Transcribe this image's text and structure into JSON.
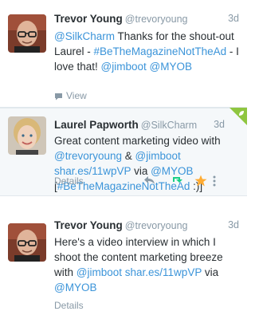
{
  "tweets": [
    {
      "fullname": "Trevor Young",
      "screenname": "@trevoryoung",
      "time": "3d",
      "avatar_icon": "bald-man-with-glasses-avatar",
      "text": [
        {
          "t": "@SilkCharm",
          "link": true
        },
        {
          "t": " Thanks for the shout-out Laurel - ",
          "link": false
        },
        {
          "t": "#BeTheMagazineNotTheAd",
          "link": true
        },
        {
          "t": " - I love that! ",
          "link": false
        },
        {
          "t": "@jimboot",
          "link": true
        },
        {
          "t": " ",
          "link": false
        },
        {
          "t": "@MYOB",
          "link": true
        }
      ],
      "footer_label": "View"
    },
    {
      "fullname": "Laurel Papworth",
      "screenname": "@SilkCharm",
      "time": "3d",
      "avatar_icon": "blonde-woman-avatar",
      "text": [
        {
          "t": "Great content marketing video with ",
          "link": false
        },
        {
          "t": "@trevoryoung",
          "link": true
        },
        {
          "t": " & ",
          "link": false
        },
        {
          "t": "@jimboot",
          "link": true
        },
        {
          "t": " ",
          "link": false
        },
        {
          "t": "shar.es/11wpVP",
          "link": true
        },
        {
          "t": " via ",
          "link": false
        },
        {
          "t": "@MYOB",
          "link": true
        },
        {
          "t": " [",
          "link": false
        },
        {
          "t": "#BeTheMagazineNotTheAd",
          "link": true
        },
        {
          "t": " :)]",
          "link": false
        }
      ],
      "footer_label": "Details",
      "accent_colors": {
        "reply": "#8899a6",
        "retweet": "#19cf86",
        "favorite": "#ffac33",
        "more": "#8899a6",
        "corner": "#8fc640"
      }
    },
    {
      "fullname": "Trevor Young",
      "screenname": "@trevoryoung",
      "time": "3d",
      "avatar_icon": "bald-man-with-glasses-avatar",
      "text": [
        {
          "t": "Here's a video interview in which I shoot the content marketing breeze with ",
          "link": false
        },
        {
          "t": "@jimboot",
          "link": true
        },
        {
          "t": " ",
          "link": false
        },
        {
          "t": "shar.es/11wpVP",
          "link": true
        },
        {
          "t": " via ",
          "link": false
        },
        {
          "t": "@MYOB",
          "link": true
        }
      ],
      "footer_label": "Details"
    }
  ],
  "colors": {
    "link": "#3b94d9",
    "muted": "#8899a6",
    "text": "#292f33",
    "highlight_bg": "#f5f8fa"
  }
}
